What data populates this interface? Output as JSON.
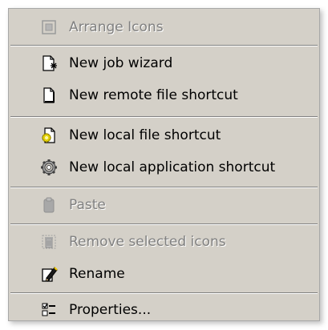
{
  "menu": {
    "items": [
      {
        "label": "Arrange Icons",
        "icon": "arrange-icons-icon",
        "enabled": false
      },
      {
        "label": "New job wizard",
        "icon": "job-wizard-icon",
        "enabled": true
      },
      {
        "label": "New remote file shortcut",
        "icon": "document-icon",
        "enabled": true
      },
      {
        "label": "New local file shortcut",
        "icon": "new-file-sparkle-icon",
        "enabled": true
      },
      {
        "label": "New local application shortcut",
        "icon": "gear-icon",
        "enabled": true
      },
      {
        "label": "Paste",
        "icon": "clipboard-icon",
        "enabled": false
      },
      {
        "label": "Remove selected icons",
        "icon": "trash-icon",
        "enabled": false
      },
      {
        "label": "Rename",
        "icon": "rename-icon",
        "enabled": true
      },
      {
        "label": "Properties...",
        "icon": "properties-icon",
        "enabled": true
      }
    ]
  },
  "colors": {
    "menu_bg": "#d4d0c8",
    "text": "#000000",
    "disabled_text": "#808080",
    "separator_dark": "#808080",
    "separator_light": "#ffffff"
  }
}
